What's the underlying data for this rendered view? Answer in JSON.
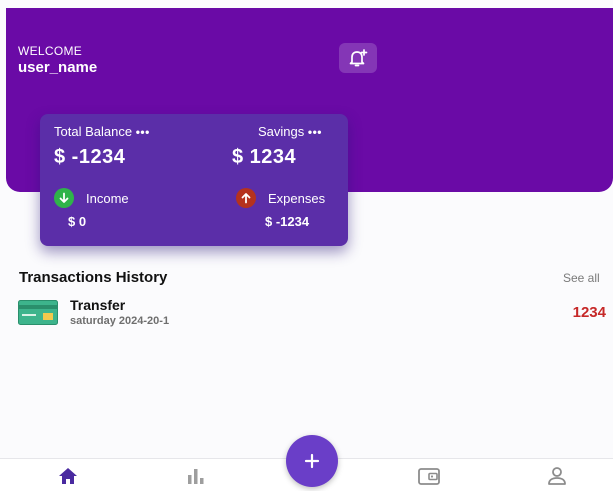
{
  "header": {
    "welcome_text": "WELCOME",
    "username": "user_name",
    "notification_icon": "bell-plus-icon"
  },
  "balance_card": {
    "total_balance_label": "Total Balance",
    "total_balance_value": "$ -1234",
    "savings_label": "Savings",
    "savings_value": "$ 1234",
    "more_dots": "•••",
    "income_label": "Income",
    "income_value": "$ 0",
    "expenses_label": "Expenses",
    "expenses_value": "$ -1234"
  },
  "transactions": {
    "title": "Transactions History",
    "see_all_label": "See all",
    "items": [
      {
        "title": "Transfer",
        "date": "saturday  2024-20-1",
        "amount": "1234",
        "icon": "credit-card-icon"
      }
    ]
  },
  "bottom_nav": {
    "items": [
      "home-icon",
      "stats-icon",
      "add-icon",
      "wallet-icon",
      "profile-icon"
    ],
    "fab_symbol": "+"
  },
  "colors": {
    "header": "#6a0aa6",
    "card": "#5b2ea8",
    "income_green": "#2fb34a",
    "expense_red": "#b5321e",
    "amount_red": "#c62828",
    "active_nav": "#4a2aa0"
  }
}
